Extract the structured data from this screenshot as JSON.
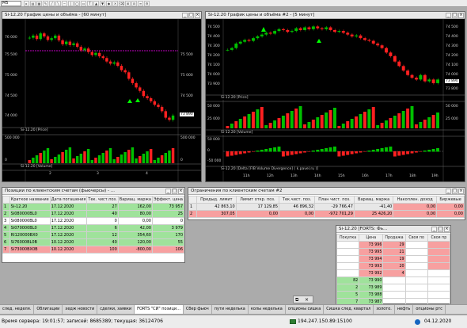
{
  "toolbar": {
    "timeframe": "M5"
  },
  "chart1": {
    "title": "Si-12.20 График цены и объёма - [60 минут]",
    "price_ticks": [
      "76 000",
      "75 500",
      "75 000",
      "74 500",
      "74 000"
    ],
    "price_right": [
      "75 500",
      "75 000",
      "74 500",
      "73 890"
    ],
    "price_label": "Si-12.20 [Price]",
    "volume_ticks": [
      "500 000",
      "0"
    ],
    "volume_right": [
      "500 000",
      "0"
    ],
    "volume_label": "Si-12.20 [Volume]",
    "time_labels": [
      "2",
      "3",
      "4"
    ],
    "candles": [
      75850,
      75900,
      75820,
      75950,
      75880,
      75800,
      75840,
      75900,
      75790,
      75700,
      75760,
      75680,
      75720,
      75640,
      75560,
      75600,
      75520,
      75450,
      75500,
      75420,
      75380,
      75300,
      75250,
      75280,
      75200,
      75100,
      75050,
      74900,
      74800,
      74700,
      74620,
      74500,
      74450,
      74380,
      74300,
      74250,
      74150,
      74000,
      73950,
      74050
    ]
  },
  "chart2": {
    "title": "Si-12.20 График цены и объёма #2 - [5 минут]",
    "price_ticks": [
      "74 500",
      "74 400",
      "74 300",
      "74 200",
      "74 100",
      "74 000",
      "73 900"
    ],
    "price_right": [
      "74 500",
      "74 400",
      "74 300",
      "74 200",
      "74 100",
      "74 000",
      "73 890",
      "73 800"
    ],
    "price_label": "Si-12.20 [Price]",
    "volume_ticks": [
      "50 000",
      "25 000"
    ],
    "volume_right": [
      "50 000",
      "25 000"
    ],
    "volume_label": "Si-12.20 [Volume]",
    "delta_ticks": [
      "50 000",
      "0",
      "-50 000"
    ],
    "delta_label": "Si-12.20 [Delta [FIB Volume Divergence] ( k.pavel.ru )]",
    "time_labels": [
      "11h",
      "12h",
      "13h",
      "14h",
      "15h",
      "16h",
      "17h",
      "18h",
      "19h"
    ],
    "candles": [
      74230,
      74250,
      74300,
      74320,
      74340,
      74330,
      74360,
      74380,
      74400,
      74420,
      74410,
      74440,
      74460,
      74450,
      74430,
      74440,
      74470,
      74450,
      74480,
      74460,
      74490,
      74470,
      74460,
      74480,
      74450,
      74430,
      74440,
      74420,
      74400,
      74380,
      74390,
      74360,
      74340,
      74330,
      74300,
      74280,
      74250,
      74200,
      74160,
      74100,
      74050,
      74000,
      73950,
      73920,
      73900,
      73950,
      73880,
      73900,
      73860,
      73900
    ]
  },
  "positions": {
    "title": "Позиции по клиентским счетам (фьючерсы) - ...",
    "headers": [
      "",
      "Краткое название",
      "Дата погашения",
      "Тек. чист.поз.",
      "Вариац. маржа",
      "Эффект. цена"
    ],
    "rows": [
      {
        "n": "1",
        "name": "Si-12.20",
        "date": "17.12.2020",
        "pos": "27",
        "margin": "162,00",
        "eff": "73 957",
        "cls": "g"
      },
      {
        "n": "2",
        "name": "Si080000BL0",
        "date": "17.12.2020",
        "pos": "40",
        "margin": "80,00",
        "eff": "25",
        "cls": "g"
      },
      {
        "n": "3",
        "name": "Si080000BL0",
        "date": "17.12.2020",
        "pos": "0",
        "margin": "0,00",
        "eff": "0",
        "cls": ""
      },
      {
        "n": "4",
        "name": "Si070000BL0",
        "date": "17.12.2020",
        "pos": "6",
        "margin": "42,00",
        "eff": "3 979",
        "cls": "g"
      },
      {
        "n": "5",
        "name": "RI120000BX0",
        "date": "17.12.2020",
        "pos": "12",
        "margin": "354,60",
        "eff": "170",
        "cls": "g"
      },
      {
        "n": "6",
        "name": "Si76000BL0B",
        "date": "10.12.2020",
        "pos": "40",
        "margin": "120,00",
        "eff": "55",
        "cls": "g"
      },
      {
        "n": "7",
        "name": "Si73000BX0B",
        "date": "10.12.2020",
        "pos": "100",
        "margin": "-800,00",
        "eff": "106",
        "cls": "r"
      }
    ]
  },
  "limits": {
    "title": "Ограничения по клиентским счетам #2",
    "headers": [
      "",
      "Предыд. лимит",
      "Лимит откр. поз.",
      "Тек.чист. поз.",
      "План чист. поз.",
      "Вариац. маржа",
      "Накоплен. доход",
      "Биржевые"
    ],
    "rows": [
      {
        "n": "1",
        "a": "42 863,10",
        "b": "17 129,85",
        "c": "46 896,32",
        "d": "-29 766,47",
        "e": "-41,40",
        "f": "0,00",
        "g": "0,00"
      },
      {
        "n": "2",
        "a": "307,05",
        "b": "0,00",
        "c": "0,00",
        "d": "-972 701,29",
        "e": "25 426,20",
        "f": "0,00",
        "g": "0,00"
      }
    ]
  },
  "depth": {
    "title": "Si-12.20 [FORTS: Фь...",
    "headers": [
      "Покупка",
      "Цена",
      "Продажа",
      "Своя по",
      "Своя пр"
    ],
    "sell": [
      {
        "price": "73 996",
        "vol": "29"
      },
      {
        "price": "73 995",
        "vol": "21"
      },
      {
        "price": "73 994",
        "vol": "19"
      },
      {
        "price": "73 993",
        "vol": "20"
      },
      {
        "price": "73 992",
        "vol": "4"
      }
    ],
    "buy": [
      {
        "price": "73 990",
        "vol": "82"
      },
      {
        "price": "73 989",
        "vol": "2"
      },
      {
        "price": "73 988",
        "vol": "5"
      },
      {
        "price": "73 987",
        "vol": "7"
      },
      {
        "price": "73 986",
        "vol": "26"
      }
    ]
  },
  "tabs": [
    "след. неделя.",
    "Облигации",
    "хедж новости",
    "сделки, заявки",
    "FORTS \"СИ\" позици...",
    "Сбер фьюч",
    "пути неделька",
    "колы неделька",
    "опционы сишка",
    "Сишка след. квартал",
    "золото.",
    "нефть",
    "опционы ртс"
  ],
  "active_tab": 4,
  "status": {
    "server_time": "Время сервера: 19:01:57; записей: 8685389; текущая: 36124706",
    "ip": "194.247.150.89:15100",
    "date": "04.12.2020"
  }
}
